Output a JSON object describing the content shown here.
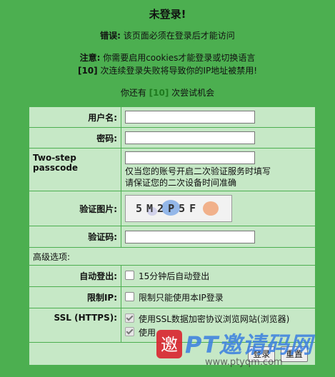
{
  "title": "未登录!",
  "error": {
    "label": "错误:",
    "text": " 该页面必须在登录后才能访问"
  },
  "notice": {
    "label": "注意:",
    "text": " 你需要启用cookies才能登录或切换语言"
  },
  "warning": {
    "count": "[10]",
    "text": " 次连续登录失败将导致你的IP地址被禁用!"
  },
  "chances": {
    "prefix": "你还有 ",
    "count": "[10]",
    "suffix": " 次尝试机会"
  },
  "form": {
    "username_label": "用户名:",
    "password_label": "密码:",
    "twostep_label": "Two-step passcode",
    "twostep_hint1": "仅当您的账号开启二次验证服务时填写",
    "twostep_hint2": "请保证您的二次设备时间准确",
    "captcha_label": "验证图片:",
    "captcha_text": "5M2P5F",
    "code_label": "验证码:",
    "advanced_label": "高级选项:",
    "autologout_label": "自动登出:",
    "autologout_option": "15分钟后自动登出",
    "restrictip_label": "限制IP:",
    "restrictip_option": "限制只能使用本IP登录",
    "ssl_label": "SSL (HTTPS):",
    "ssl_option1": "使用SSL数据加密协议浏览网站(浏览器)",
    "ssl_option2": "使用",
    "submit_label": "登录",
    "reset_label": "重置"
  },
  "watermark": {
    "main": "PT邀请码网",
    "url": "www.ptyqm.com",
    "seal": "邀"
  }
}
